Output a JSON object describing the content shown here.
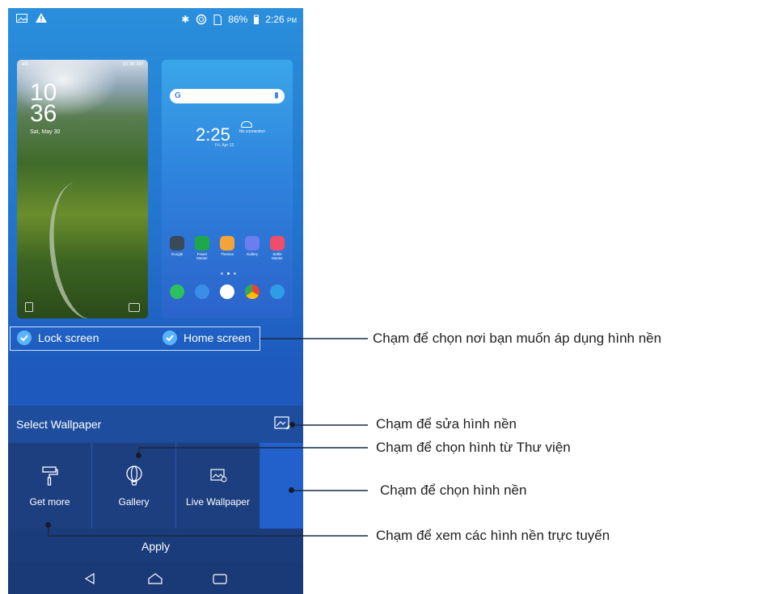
{
  "status_bar": {
    "battery": "86%",
    "time": "2:26",
    "ampm": "PM"
  },
  "lock_preview": {
    "time_hour": "10",
    "time_min": "36",
    "date": "Sat, May 30",
    "status_time": "10:36 AM",
    "signal": "4G"
  },
  "home_preview": {
    "search_g": "G",
    "clock": "2:25",
    "weather": "No connection",
    "date": "Fri, Apr 13",
    "apps_row1": [
      {
        "label": "Google",
        "color": "#3a4a5a"
      },
      {
        "label": "Power Master",
        "color": "#1fa84a"
      },
      {
        "label": "Themes",
        "color": "#f3a33a"
      },
      {
        "label": "Gallery",
        "color": "#6a7ef0"
      },
      {
        "label": "Selfie Master",
        "color": "#ee4e6a"
      }
    ],
    "apps_row2": [
      {
        "label": "",
        "color": "#2cc060"
      },
      {
        "label": "",
        "color": "#3a8ee8"
      },
      {
        "label": "",
        "color": "#ffffff"
      },
      {
        "label": "",
        "color": "#ffffff"
      },
      {
        "label": "",
        "color": "#2f9ce8"
      }
    ]
  },
  "targets": {
    "lock": "Lock screen",
    "home": "Home screen"
  },
  "select_wallpaper": "Select Wallpaper",
  "options": [
    {
      "label": "Get more",
      "icon": "paint-roller-icon"
    },
    {
      "label": "Gallery",
      "icon": "balloon-icon"
    },
    {
      "label": "Live Wallpaper",
      "icon": "live-wallpaper-icon"
    }
  ],
  "apply": "Apply",
  "callouts": {
    "target": "Chạm để chọn nơi bạn muốn áp dụng hình nền",
    "edit": "Chạm để sửa hình nền",
    "gallery": "Chạm để chọn hình từ Thư viện",
    "wallpaper": "Chạm để chọn hình nền",
    "online": "Chạm để xem các hình nền trực tuyến"
  },
  "colors": {
    "accent": "#5ab3ff",
    "panel": "#1d3f80"
  }
}
